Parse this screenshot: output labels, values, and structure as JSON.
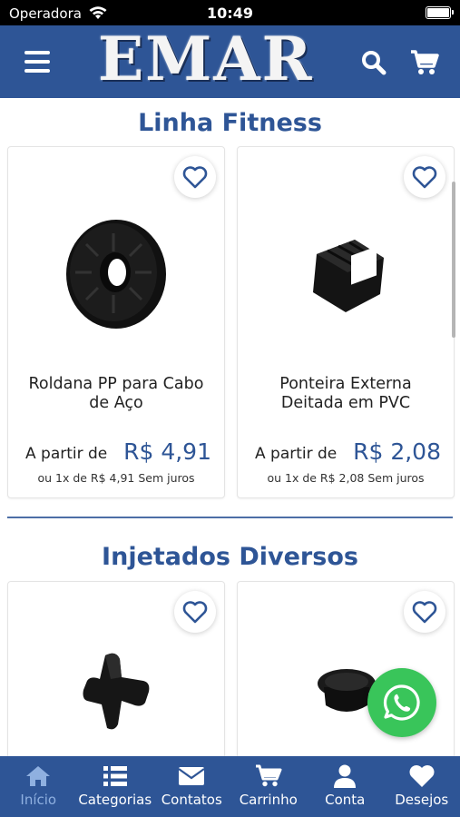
{
  "status_bar": {
    "carrier": "Operadora",
    "time": "10:49"
  },
  "header": {
    "logo_text": "EMAR"
  },
  "sections": [
    {
      "title": "Linha Fitness",
      "products": [
        {
          "name": "Roldana PP para Cabo de Aço",
          "from_label": "A partir de",
          "price": "R$ 4,91",
          "installment": "ou 1x de R$ 4,91 Sem juros"
        },
        {
          "name": "Ponteira Externa Deitada em PVC",
          "from_label": "A partir de",
          "price": "R$ 2,08",
          "installment": "ou 1x de R$ 2,08 Sem juros"
        }
      ]
    },
    {
      "title": "Injetados Diversos",
      "products": [
        {
          "name": "",
          "from_label": "",
          "price": "",
          "installment": ""
        },
        {
          "name": "",
          "from_label": "",
          "price": "",
          "installment": ""
        }
      ]
    }
  ],
  "tabbar": {
    "items": [
      {
        "label": "Início",
        "icon": "home-icon",
        "active": true
      },
      {
        "label": "Categorias",
        "icon": "list-icon",
        "active": false
      },
      {
        "label": "Contatos",
        "icon": "envelope-icon",
        "active": false
      },
      {
        "label": "Carrinho",
        "icon": "cart-icon",
        "active": false
      },
      {
        "label": "Conta",
        "icon": "user-icon",
        "active": false
      },
      {
        "label": "Desejos",
        "icon": "heart-icon",
        "active": false
      }
    ]
  },
  "colors": {
    "brand": "#2e5596",
    "active_tab": "#8fb0e0",
    "whatsapp": "#39c55a"
  }
}
